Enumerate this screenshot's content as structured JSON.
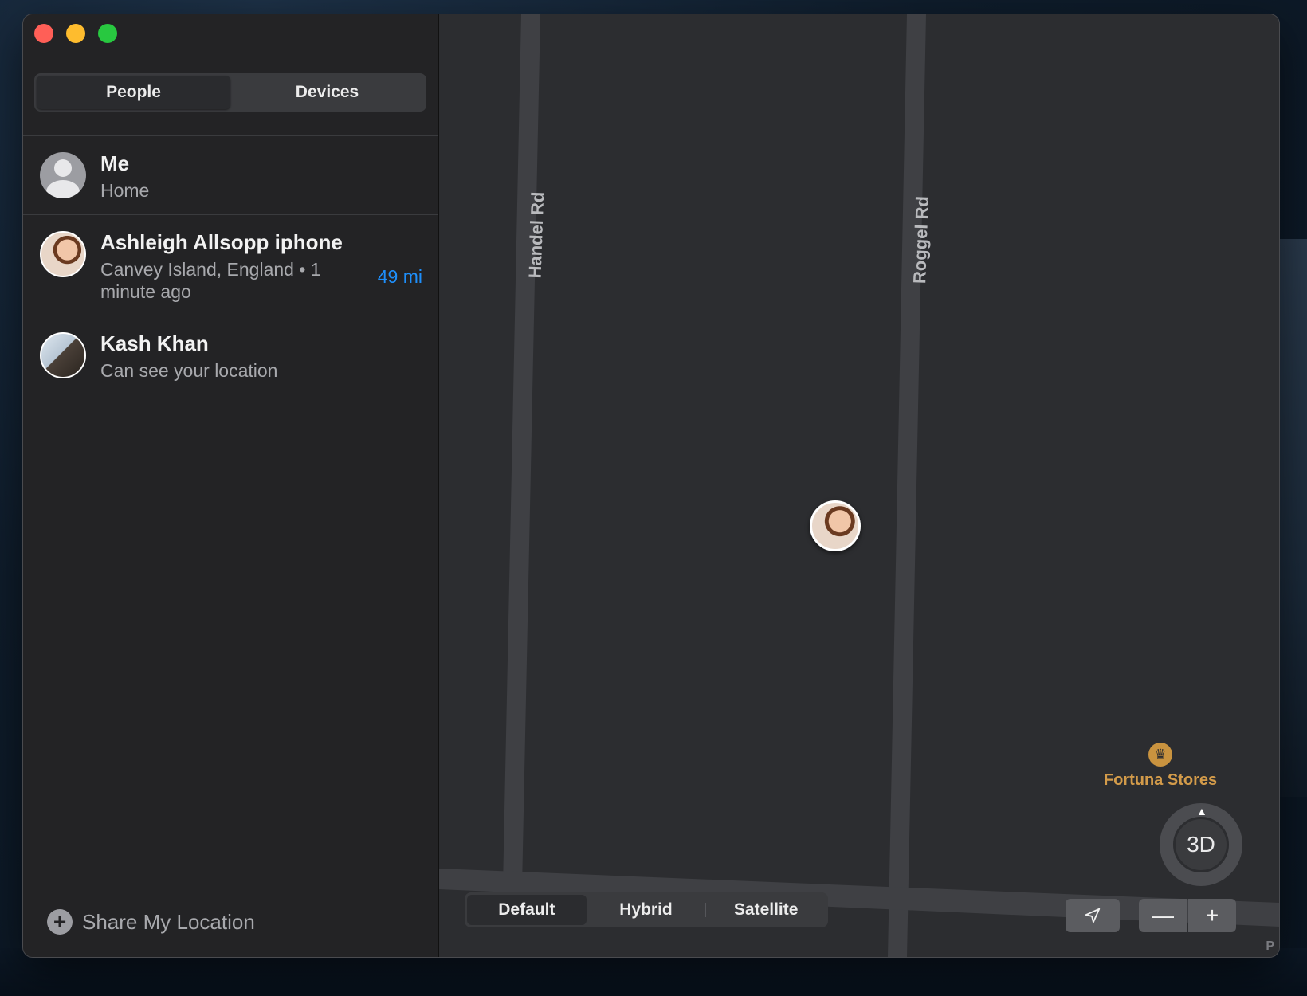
{
  "window": {
    "tabs": [
      {
        "label": "People",
        "active": true
      },
      {
        "label": "Devices",
        "active": false
      }
    ]
  },
  "people": [
    {
      "name": "Me",
      "subtitle": "Home",
      "avatar_icon": "generic-person-icon"
    },
    {
      "name": "Ashleigh Allsopp iphone",
      "subtitle": "Canvey Island, England • 1 minute ago",
      "distance": "49 mi",
      "avatar_icon": "contact-photo"
    },
    {
      "name": "Kash Khan",
      "subtitle": "Can see your location",
      "avatar_icon": "contact-photo"
    }
  ],
  "share_location": {
    "label": "Share My Location",
    "icon": "plus-circle-icon"
  },
  "map": {
    "roads": [
      "Handel Rd",
      "Roggel Rd"
    ],
    "poi": {
      "label": "Fortuna Stores",
      "icon": "basket-icon"
    },
    "compass_label": "3D",
    "map_types": [
      {
        "label": "Default",
        "active": true
      },
      {
        "label": "Hybrid",
        "active": false
      },
      {
        "label": "Satellite",
        "active": false
      }
    ],
    "credit": "P"
  },
  "colors": {
    "accent": "#1e8ffb",
    "poi": "#d39b4a",
    "close": "#ff5f57",
    "minimize": "#febc2e",
    "zoom": "#28c840"
  }
}
